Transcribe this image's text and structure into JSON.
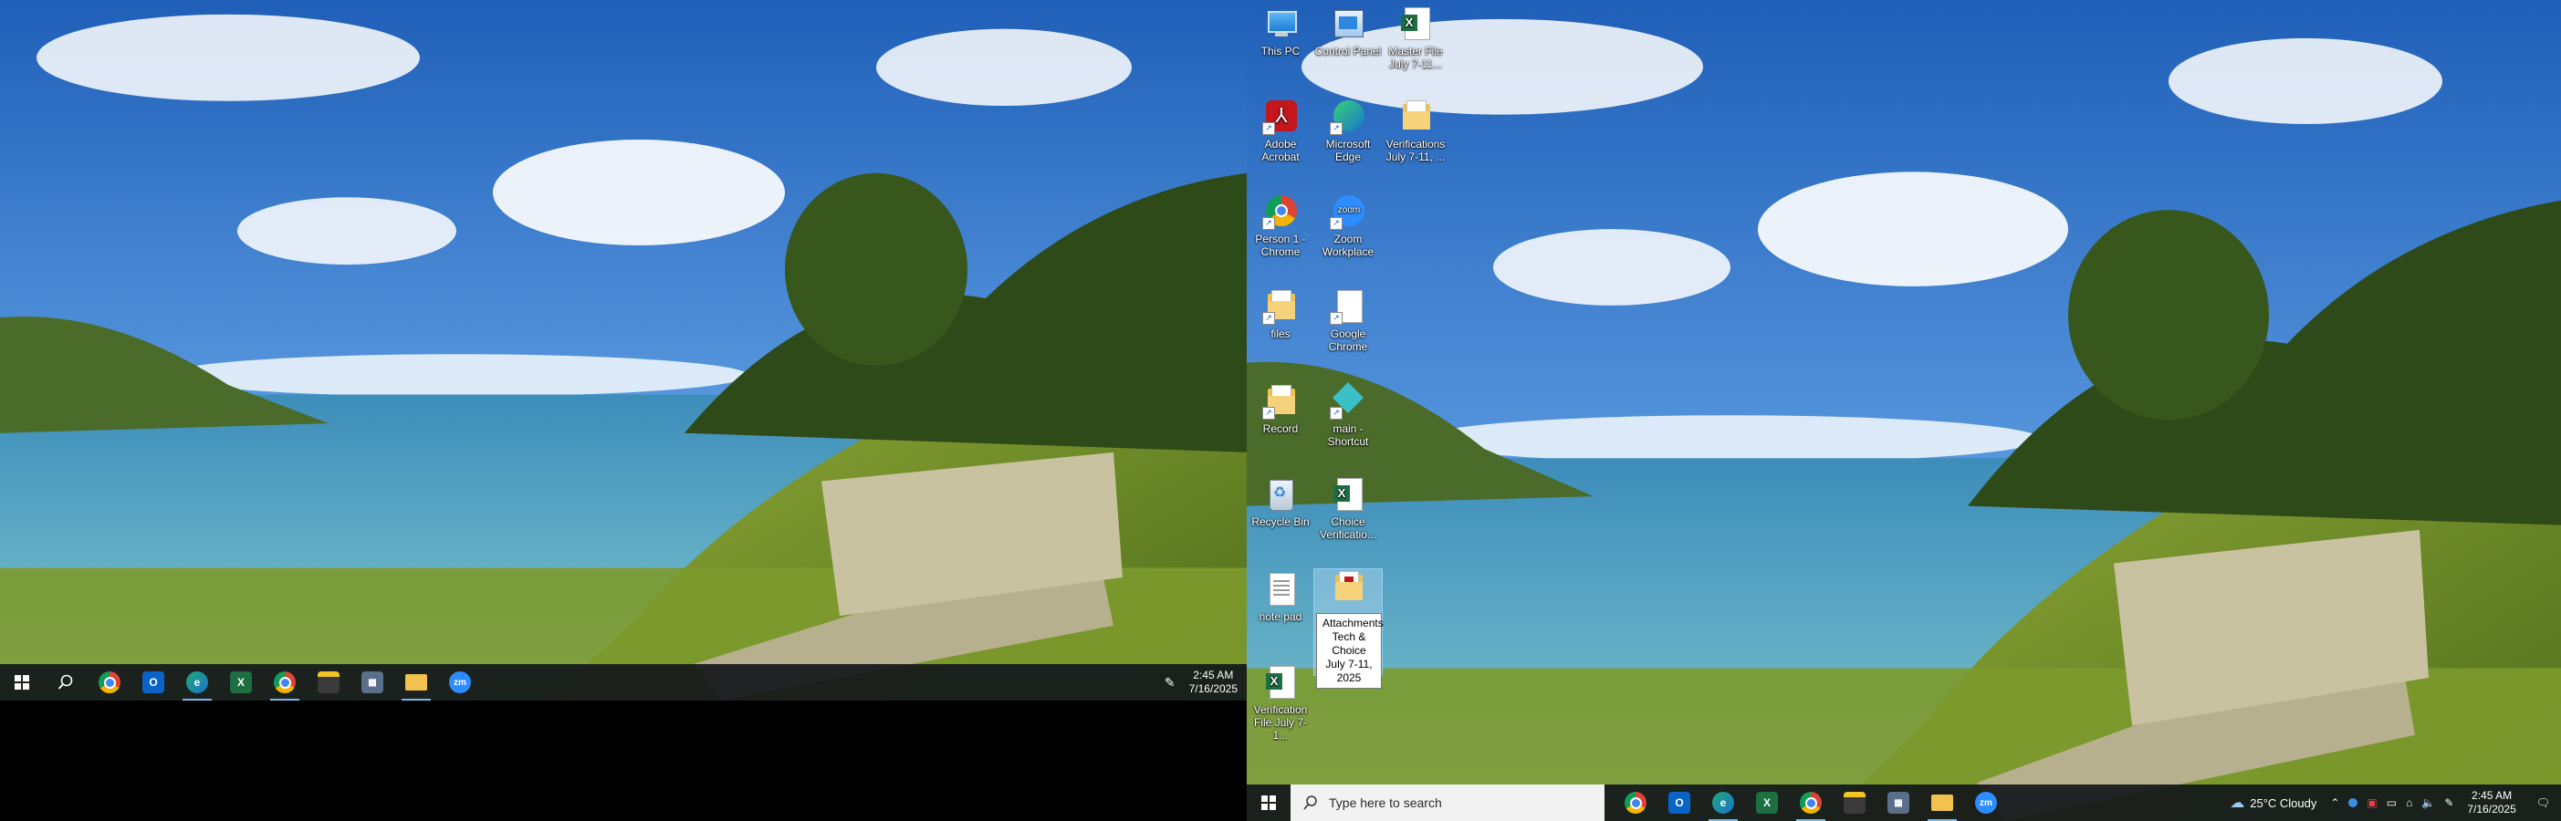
{
  "left_monitor": {
    "taskbar": {
      "apps": [
        {
          "name": "Google Chrome"
        },
        {
          "name": "Outlook"
        },
        {
          "name": "Microsoft Edge"
        },
        {
          "name": "Excel"
        },
        {
          "name": "Chrome Person 1"
        },
        {
          "name": "Sticky Notes"
        },
        {
          "name": "Calculator"
        },
        {
          "name": "File Explorer"
        },
        {
          "name": "Zoom"
        }
      ],
      "clock_time": "2:45 AM",
      "clock_date": "7/16/2025"
    }
  },
  "right_monitor": {
    "desktop_icons": [
      {
        "label": "This PC",
        "icon": "pc-icon"
      },
      {
        "label": "Control Panel",
        "icon": "control-panel-icon"
      },
      {
        "label": "Master File July 7-11...",
        "icon": "excel-file-icon"
      },
      {
        "label": "Adobe Acrobat",
        "icon": "acrobat-icon"
      },
      {
        "label": "Microsoft Edge",
        "icon": "edge-icon"
      },
      {
        "label": "Verifications July 7-11, ...",
        "icon": "folder-icon"
      },
      {
        "label": "Person 1 - Chrome",
        "icon": "chrome-icon"
      },
      {
        "label": "Zoom Workplace",
        "icon": "zoom-icon"
      },
      {
        "label": "files",
        "icon": "folder-icon"
      },
      {
        "label": "Google Chrome",
        "icon": "blank-file-icon"
      },
      {
        "label": "Record",
        "icon": "folder-icon"
      },
      {
        "label": "main - Shortcut",
        "icon": "app-shortcut-icon"
      },
      {
        "label": "Recycle Bin",
        "icon": "recycle-bin-icon"
      },
      {
        "label": "Choice Verificatio...",
        "icon": "excel-file-icon"
      },
      {
        "label": "note pad",
        "icon": "text-file-icon"
      },
      {
        "label": "Attachments Tech & Choice July 7-11, 2025",
        "icon": "folder-icon"
      },
      {
        "label": "Verification File July 7-1...",
        "icon": "excel-file-icon"
      }
    ],
    "taskbar": {
      "search_placeholder": "Type here to search",
      "apps": [
        {
          "name": "Google Chrome"
        },
        {
          "name": "Outlook"
        },
        {
          "name": "Microsoft Edge"
        },
        {
          "name": "Excel"
        },
        {
          "name": "Chrome Person 1"
        },
        {
          "name": "Sticky Notes"
        },
        {
          "name": "Calculator"
        },
        {
          "name": "File Explorer"
        },
        {
          "name": "Zoom"
        }
      ],
      "weather": "25°C  Cloudy",
      "clock_time": "2:45 AM",
      "clock_date": "7/16/2025"
    }
  },
  "colors": {
    "taskbar": "#12161a",
    "sky": "#3a78c8",
    "sea": "#2f8fb5",
    "grass": "#7a9a2e"
  }
}
